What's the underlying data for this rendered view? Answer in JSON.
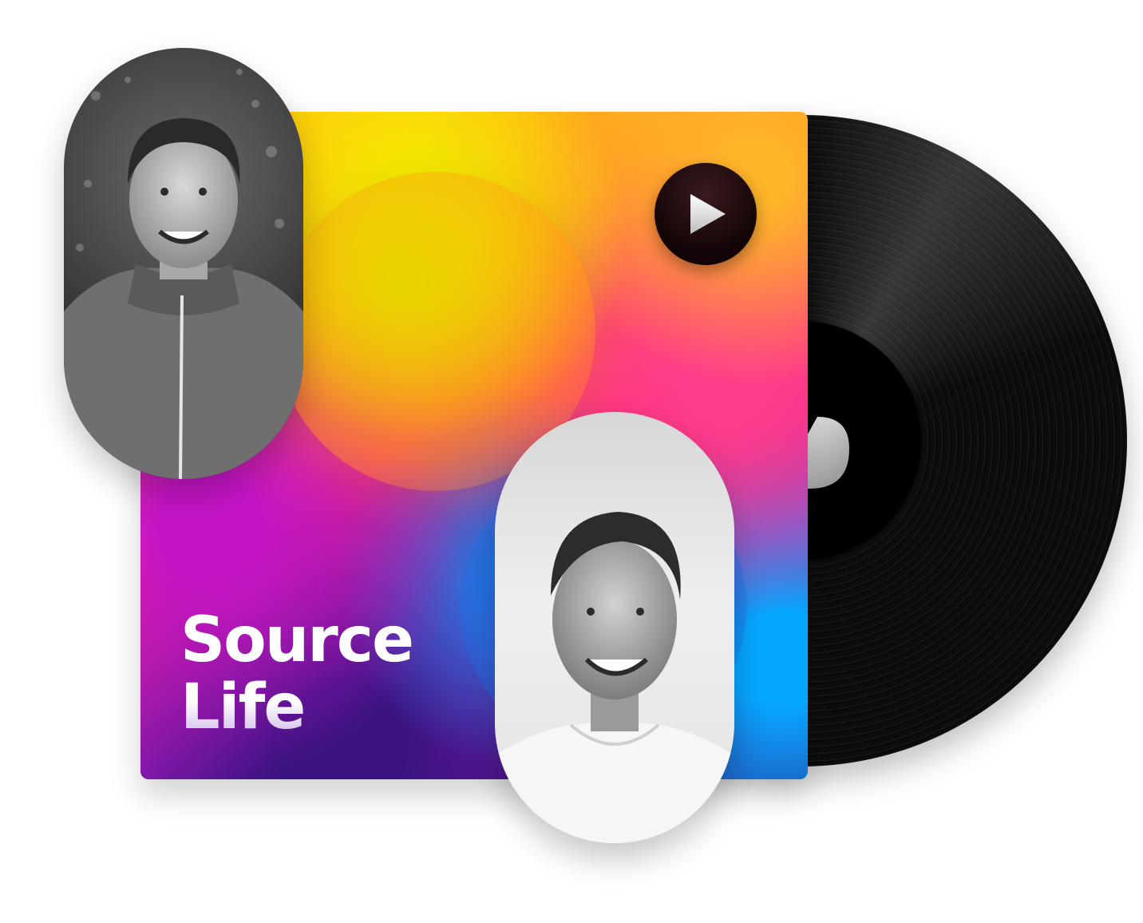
{
  "album": {
    "title_line1": "Source",
    "title_line2": "Life"
  },
  "icons": {
    "play": "play-icon",
    "waveform": "waveform-icon",
    "record_logo": "record-logo-icon"
  },
  "colors": {
    "gradient": [
      "#f6f300",
      "#ffb52a",
      "#ff2e7a",
      "#c414c6",
      "#06a6ff",
      "#2a1680"
    ],
    "vinyl": "#0d0d0d",
    "play_button": "#1a070a"
  }
}
